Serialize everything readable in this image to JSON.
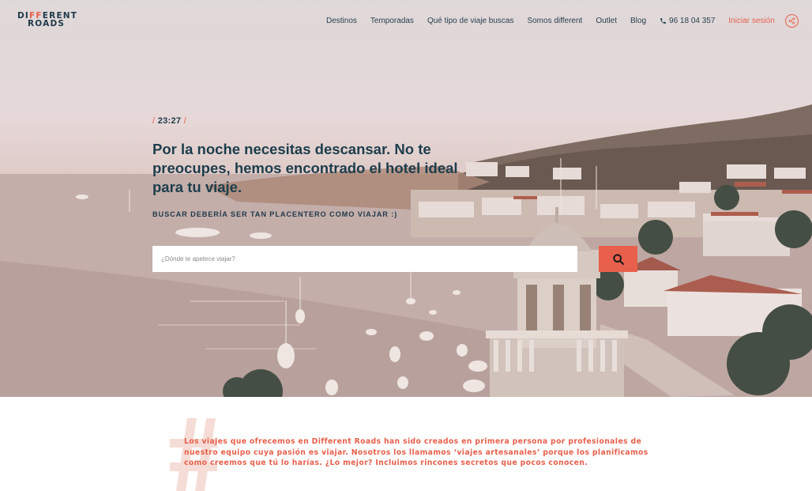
{
  "brand": {
    "logo_line1_start": "DI",
    "logo_line1_ff": "FF",
    "logo_line1_end": "ERENT",
    "logo_line2": "ROADS"
  },
  "nav": {
    "items": [
      "Destinos",
      "Temporadas",
      "Qué tipo de viaje buscas",
      "Somos different",
      "Outlet",
      "Blog"
    ],
    "phone": "96 18 04 357",
    "login": "Iniciar sesión"
  },
  "hero": {
    "time": "23:27",
    "time_slash": "/",
    "headline": "Por la noche necesitas descansar. No te preocupes, hemos encontrado el hotel ideal para tu viaje.",
    "subhead": "BUSCAR DEBERÍA SER TAN PLACENTERO COMO VIAJAR :)",
    "search_placeholder": "¿Dónde te apetece viajar?"
  },
  "intro": {
    "text": "Los viajes que ofrecemos en Different Roads han sido creados en primera persona por profesionales de nuestro equipo cuya pasión es viajar. Nosotros los llamamos ‘viajes artesanales’ porque los planificamos como creemos que tú lo harías. ¿Lo mejor? Incluimos rincones secretos que pocos conocen."
  },
  "colors": {
    "accent": "#e8604c",
    "text_dark": "#1f3a4a",
    "hero_sky": "#e0d6d7"
  },
  "icons": [
    "phone-icon",
    "share-icon",
    "search-icon"
  ]
}
